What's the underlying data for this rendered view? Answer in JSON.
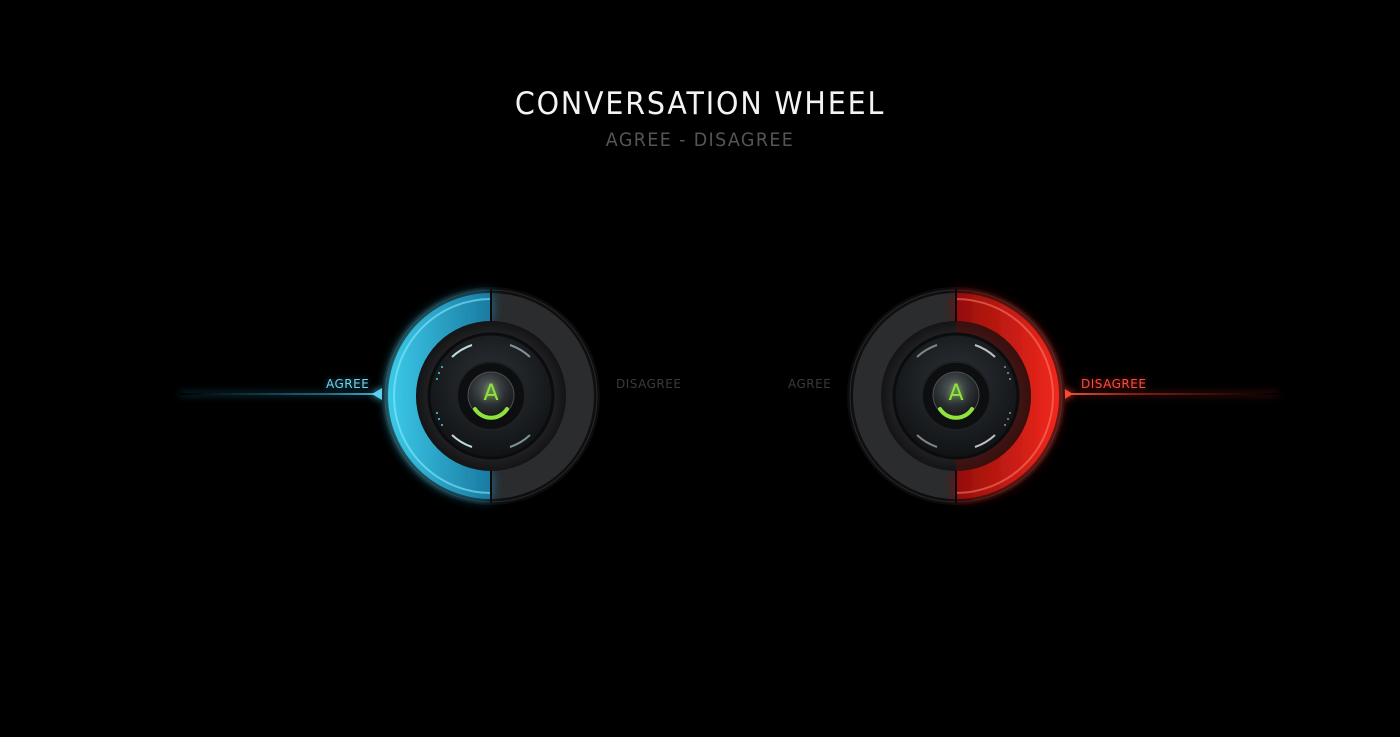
{
  "header": {
    "title": "CONVERSATION WHEEL",
    "subtitle": "AGREE - DISAGREE"
  },
  "wheels": [
    {
      "id": "agree-state",
      "active_option": "agree",
      "left_label": "AGREE",
      "right_label": "DISAGREE",
      "center_button": "A",
      "accent_color": "#3cc6ea"
    },
    {
      "id": "disagree-state",
      "active_option": "disagree",
      "left_label": "AGREE",
      "right_label": "DISAGREE",
      "center_button": "A",
      "accent_color": "#ff2a1e"
    }
  ],
  "colors": {
    "background": "#000000",
    "agree_accent": "#3cc6ea",
    "disagree_accent": "#ff2a1e",
    "button_letter": "#8fe33c",
    "inactive_label": "#3a3a3a"
  },
  "icons": {
    "center_button_icon": "a-button-icon",
    "agree_pointer": "triangle-left-icon",
    "disagree_pointer": "triangle-right-icon"
  }
}
